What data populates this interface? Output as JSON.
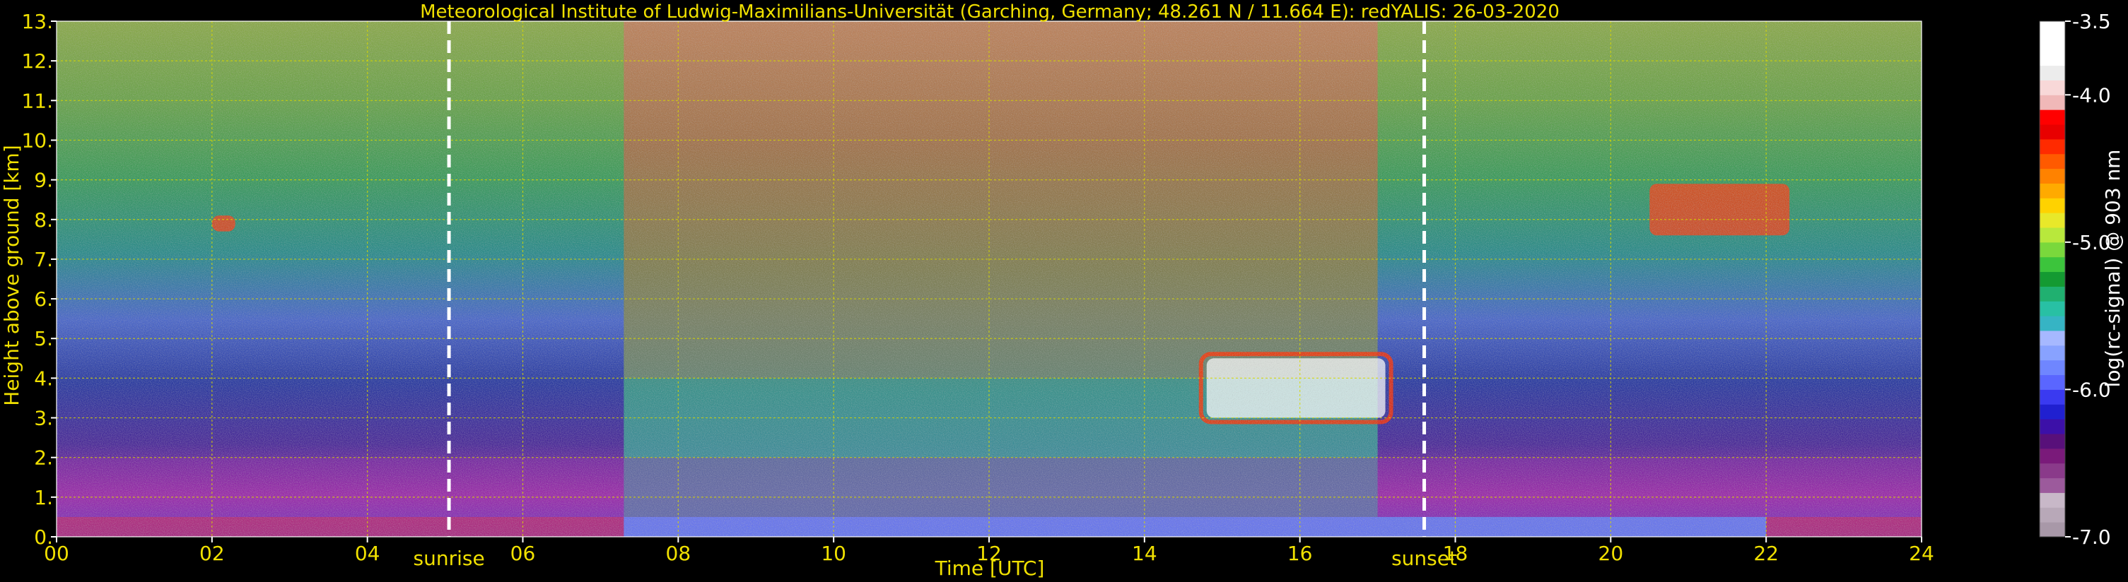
{
  "chart_data": {
    "type": "heatmap",
    "title": "Meteorological Institute of Ludwig-Maximilians-Universität (Garching, Germany; 48.261 N / 11.664 E):    redYALIS: 26-03-2020",
    "xlabel": "Time [UTC]",
    "ylabel": "Height above ground [km]",
    "xlim": [
      0,
      24
    ],
    "ylim": [
      0,
      13
    ],
    "x_ticks": [
      "00",
      "02",
      "04",
      "06",
      "08",
      "10",
      "12",
      "14",
      "16",
      "18",
      "20",
      "22",
      "24"
    ],
    "y_ticks": [
      "0.",
      "1.",
      "2.",
      "3.",
      "4.",
      "5.",
      "6.",
      "7.",
      "8.",
      "9.",
      "10.",
      "11.",
      "12.",
      "13."
    ],
    "grid": true,
    "markers": [
      {
        "label": "sunrise",
        "x": 5.05
      },
      {
        "label": "sunset",
        "x": 17.6
      }
    ],
    "colorbar": {
      "label": "log(rc-signal) @ 903 nm",
      "range": [
        -7.0,
        -3.5
      ],
      "ticks": [
        "-3.5",
        "-4.0",
        "-5.0",
        "-6.0",
        "-7.0"
      ],
      "tick_values": [
        -3.5,
        -4.0,
        -5.0,
        -6.0,
        -7.0
      ],
      "colors": [
        "#a898a8",
        "#b8a8b8",
        "#c8b8c8",
        "#9c5a9c",
        "#8a3a8a",
        "#7a1a7a",
        "#58107a",
        "#3c10a8",
        "#2020d0",
        "#3a3af0",
        "#5a66ff",
        "#6f86ff",
        "#88a2ff",
        "#a6b8ff",
        "#36b4c4",
        "#28c0a4",
        "#20b070",
        "#149a32",
        "#3cc43c",
        "#7ad83c",
        "#b8e83c",
        "#e8e82a",
        "#ffd200",
        "#ffaa00",
        "#ff8200",
        "#ff5a00",
        "#ff2a00",
        "#e80000",
        "#ff0000",
        "#f0b8b8",
        "#f8d8d8",
        "#ececec",
        "#ffffff",
        "#ffffff",
        "#ffffff"
      ]
    },
    "features": [
      {
        "name": "boundary layer",
        "x_range": [
          0,
          24
        ],
        "height_km": [
          0,
          0.5
        ]
      },
      {
        "name": "residual layer",
        "x_range": [
          0,
          24
        ],
        "height_km": [
          0.5,
          2.0
        ]
      },
      {
        "name": "cirrus",
        "x_range": [
          7.3,
          17.0
        ],
        "height_km": [
          4.0,
          13.0
        ]
      },
      {
        "name": "cloud layer",
        "x_range": [
          14.8,
          17.1
        ],
        "height_km": [
          3.0,
          4.5
        ]
      },
      {
        "name": "cloud patch",
        "x_range": [
          2.0,
          2.3
        ],
        "height_km": [
          7.7,
          8.1
        ]
      },
      {
        "name": "cloud patch",
        "x_range": [
          20.5,
          22.3
        ],
        "height_km": [
          7.6,
          8.9
        ]
      }
    ]
  }
}
